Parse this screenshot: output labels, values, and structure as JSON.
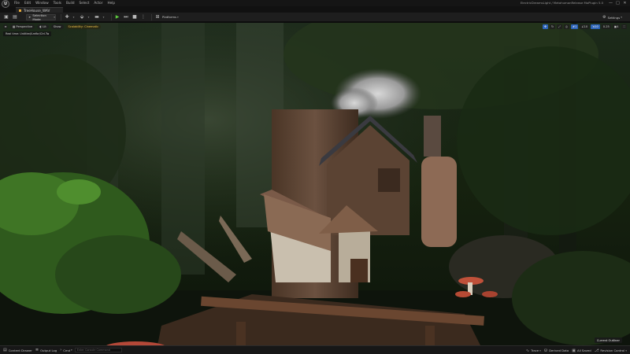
{
  "app": {
    "logo_glyph": "U",
    "project_title": "ElectricDreamsLight / MetahumanRelease MoPlugin 5.0"
  },
  "menubar": {
    "items": [
      "File",
      "Edit",
      "Window",
      "Tools",
      "Build",
      "Select",
      "Actor",
      "Help"
    ]
  },
  "window_controls": {
    "minimize": "—",
    "maximize": "□",
    "close": "✕"
  },
  "level_tab": {
    "label": "TreeHouse_WAV"
  },
  "toolbar": {
    "mode_label": "Selection Mode",
    "platforms_label": "Platforms",
    "settings_label": "Settings"
  },
  "viewport": {
    "buttons": [
      "Perspective",
      "Lit",
      "Show"
    ],
    "scalability_label": "Scalability: Cinematic",
    "note": "Real time: Untitled/Lmfbr/Ctrl.Tw",
    "right_items": [
      "1",
      "10",
      "10",
      "0.25",
      "4"
    ],
    "outliner_label": "Current Outliner"
  },
  "statusbar": {
    "content_drawer": "Content Drawer",
    "output_log": "Output Log",
    "cmd_label": "Cmd",
    "cmd_placeholder": "Enter Console Command",
    "right": [
      "Trace",
      "Derived Data",
      "All Saved",
      "Revision Control"
    ]
  },
  "colors": {
    "play_green": "#5ecb3f",
    "accent_blue": "#2d63b7",
    "scalability_yellow": "#f0c24a"
  }
}
